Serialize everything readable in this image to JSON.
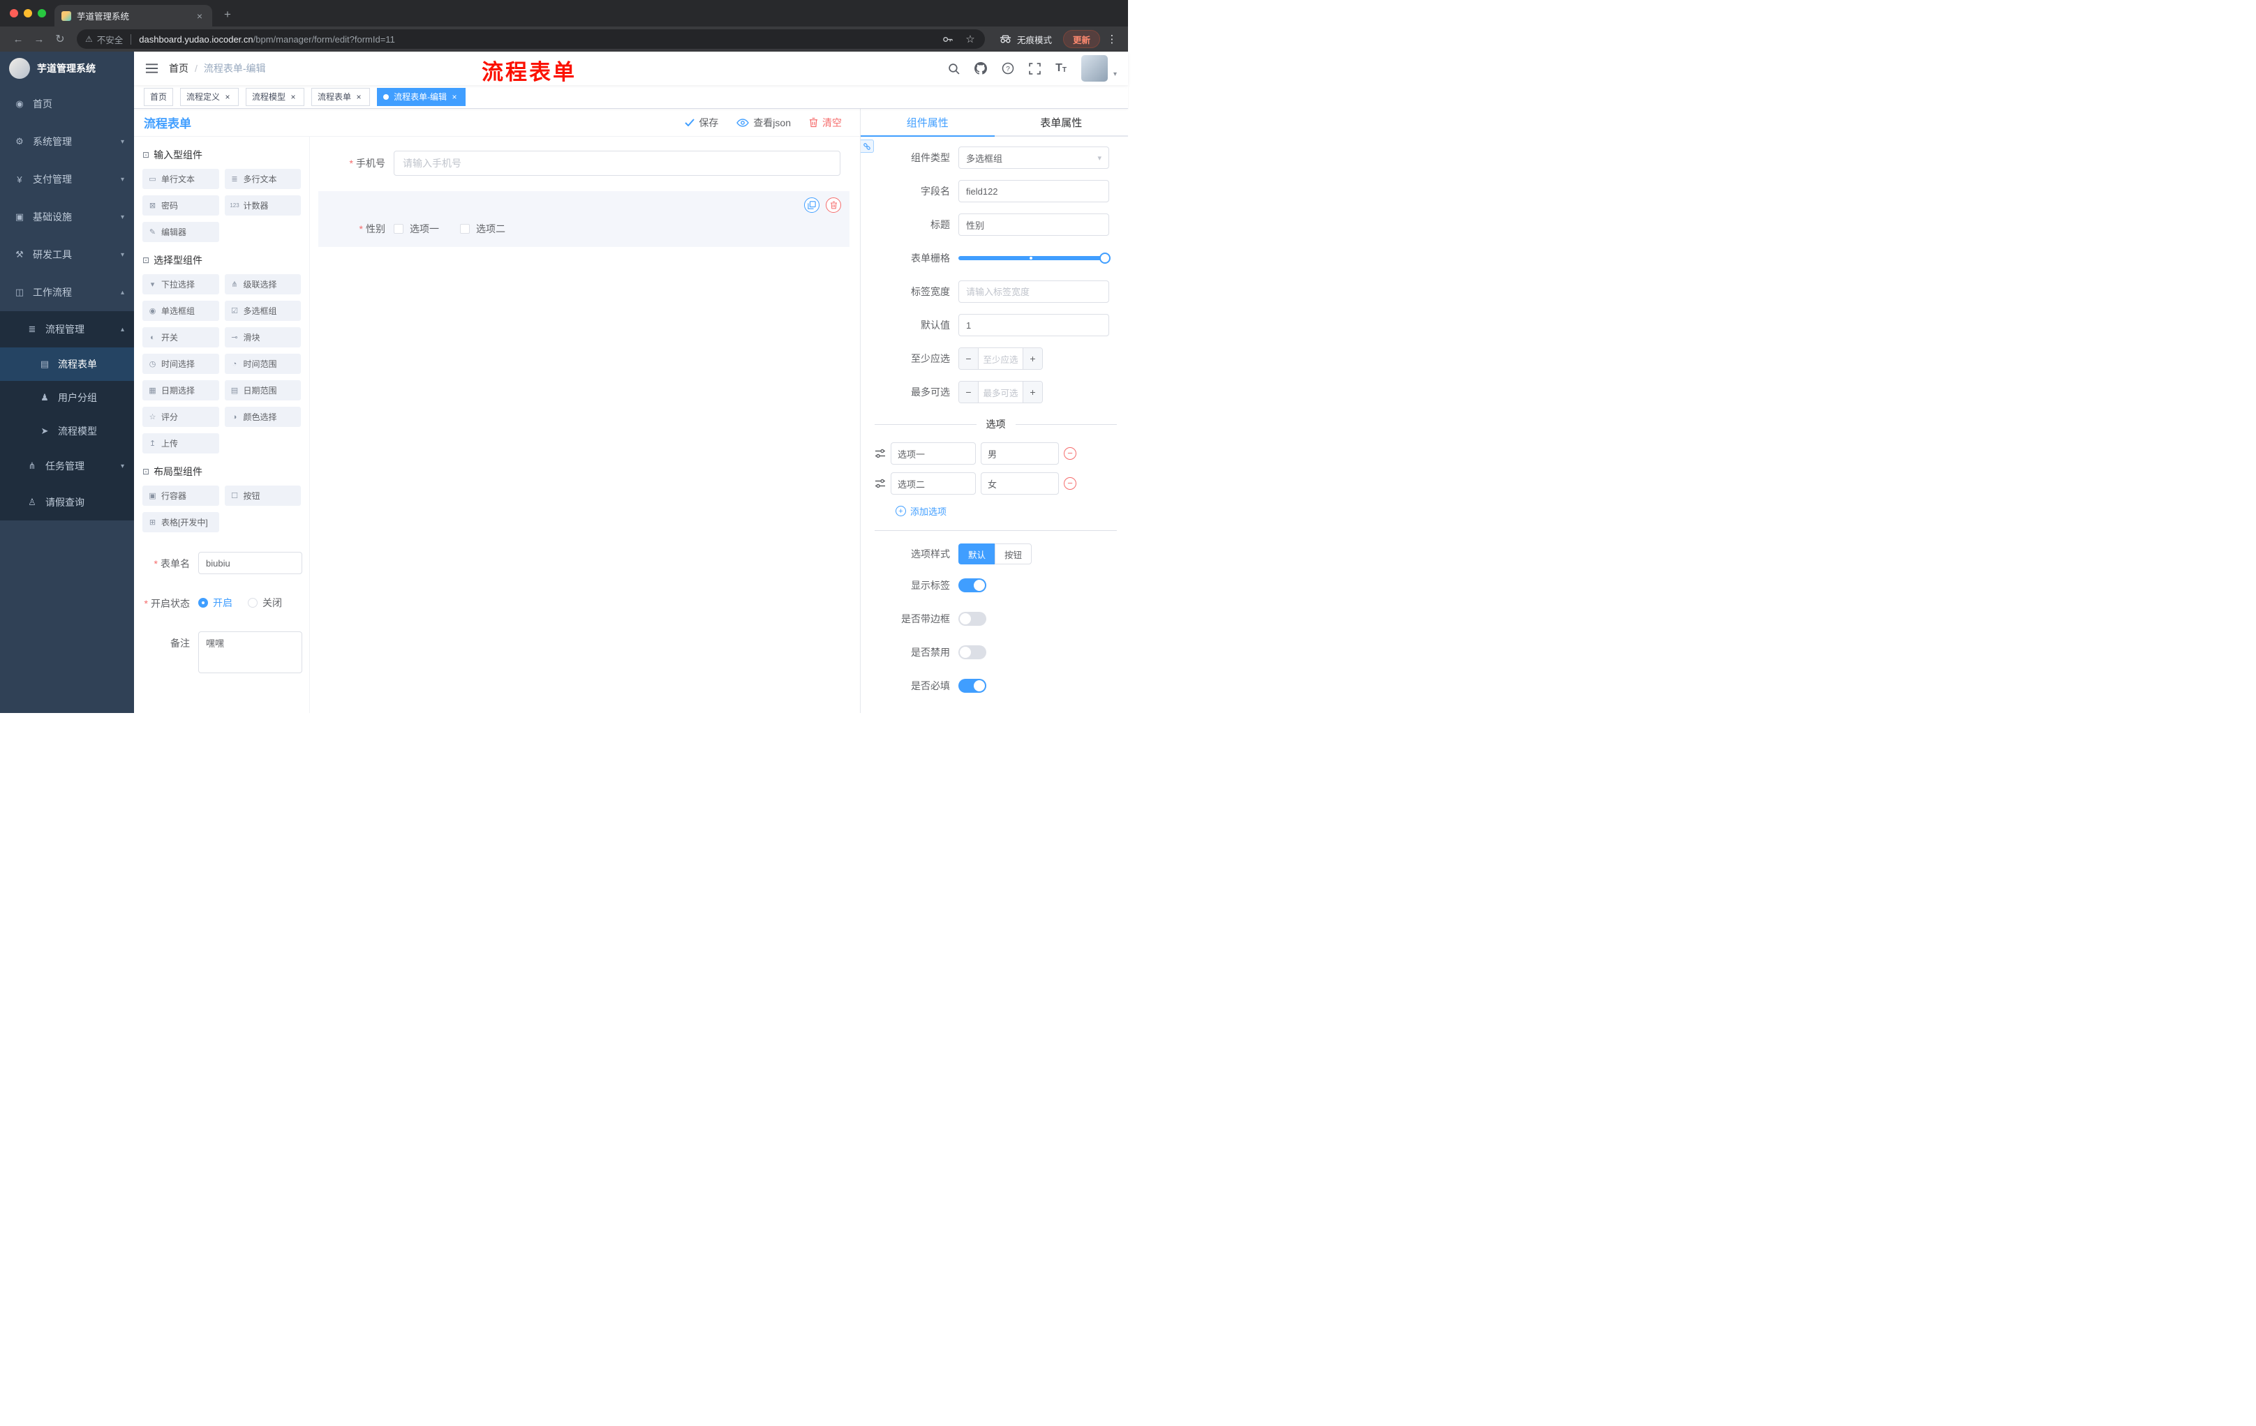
{
  "browser": {
    "tab_title": "芋道管理系统",
    "security_label": "不安全",
    "url_domain": "dashboard.yudao.iocoder.cn",
    "url_path": "/bpm/manager/form/edit?formId=11",
    "incognito_label": "无痕模式",
    "update_label": "更新"
  },
  "sidebar": {
    "title": "芋道管理系统",
    "items": [
      {
        "label": "首页",
        "icon": "◉"
      },
      {
        "label": "系统管理",
        "icon": "⚙"
      },
      {
        "label": "支付管理",
        "icon": "¥"
      },
      {
        "label": "基础设施",
        "icon": "▣"
      },
      {
        "label": "研发工具",
        "icon": "⚒"
      },
      {
        "label": "工作流程",
        "icon": "◫"
      },
      {
        "label": "流程管理",
        "icon": "≣"
      },
      {
        "label": "流程表单",
        "icon": "▤"
      },
      {
        "label": "用户分组",
        "icon": "♟"
      },
      {
        "label": "流程模型",
        "icon": "➤"
      },
      {
        "label": "任务管理",
        "icon": "⋔"
      },
      {
        "label": "请假查询",
        "icon": "♙"
      }
    ]
  },
  "header": {
    "breadcrumb_home": "首页",
    "breadcrumb_sep": "/",
    "breadcrumb_current": "流程表单-编辑",
    "annotation": "流程表单"
  },
  "tags": [
    {
      "label": "首页"
    },
    {
      "label": "流程定义"
    },
    {
      "label": "流程模型"
    },
    {
      "label": "流程表单"
    },
    {
      "label": "流程表单-编辑"
    }
  ],
  "designer": {
    "title": "流程表单",
    "group_icon": "⊡",
    "save_label": "保存",
    "view_json_label": "查看json",
    "clear_label": "清空",
    "groups": [
      {
        "title": "输入型组件",
        "items": [
          {
            "label": "单行文本",
            "icon": "▭"
          },
          {
            "label": "多行文本",
            "icon": "≣"
          },
          {
            "label": "密码",
            "icon": "⊠"
          },
          {
            "label": "计数器",
            "icon": "123"
          },
          {
            "label": "编辑器",
            "icon": "✎"
          }
        ]
      },
      {
        "title": "选择型组件",
        "items": [
          {
            "label": "下拉选择",
            "icon": "▾"
          },
          {
            "label": "级联选择",
            "icon": "⋔"
          },
          {
            "label": "单选框组",
            "icon": "◉"
          },
          {
            "label": "多选框组",
            "icon": "☑"
          },
          {
            "label": "开关",
            "icon": "◐"
          },
          {
            "label": "滑块",
            "icon": "⊸"
          },
          {
            "label": "时间选择",
            "icon": "◷"
          },
          {
            "label": "时间范围",
            "icon": "◔"
          },
          {
            "label": "日期选择",
            "icon": "▦"
          },
          {
            "label": "日期范围",
            "icon": "▤"
          },
          {
            "label": "评分",
            "icon": "☆"
          },
          {
            "label": "颜色选择",
            "icon": "◑"
          },
          {
            "label": "上传",
            "icon": "↥"
          }
        ]
      },
      {
        "title": "布局型组件",
        "items": [
          {
            "label": "行容器",
            "icon": "▣"
          },
          {
            "label": "按钮",
            "icon": "☐"
          },
          {
            "label": "表格[开发中]",
            "icon": "⊞"
          }
        ]
      }
    ],
    "config": {
      "form_name_label": "表单名",
      "form_name_value": "biubiu",
      "status_label": "开启状态",
      "status_on": "开启",
      "status_off": "关闭",
      "remark_label": "备注",
      "remark_value": "嘿嘿"
    },
    "preview": {
      "phone_label": "手机号",
      "phone_placeholder": "请输入手机号",
      "gender_label": "性别",
      "gender_opt1": "选项一",
      "gender_opt2": "选项二"
    }
  },
  "props": {
    "tab_component": "组件属性",
    "tab_form": "表单属性",
    "component_type_label": "组件类型",
    "component_type_value": "多选框组",
    "field_name_label": "字段名",
    "field_name_value": "field122",
    "title_label": "标题",
    "title_value": "性别",
    "grid_label": "表单栅格",
    "label_width_label": "标签宽度",
    "label_width_placeholder": "请输入标签宽度",
    "default_label": "默认值",
    "default_value": "1",
    "min_label": "至少应选",
    "min_placeholder": "至少应选",
    "max_label": "最多可选",
    "max_placeholder": "最多可选",
    "options_title": "选项",
    "options": [
      {
        "name": "选项一",
        "value": "男"
      },
      {
        "name": "选项二",
        "value": "女"
      }
    ],
    "add_option_label": "添加选项",
    "style_label": "选项样式",
    "style_default": "默认",
    "style_button": "按钮",
    "switch_show_label": "显示标签",
    "switch_border": "是否带边框",
    "switch_disabled": "是否禁用",
    "switch_required": "是否必填"
  },
  "colors": {
    "accent": "#409eff",
    "danger": "#f56c6c",
    "annotation_red": "#fb1101"
  }
}
